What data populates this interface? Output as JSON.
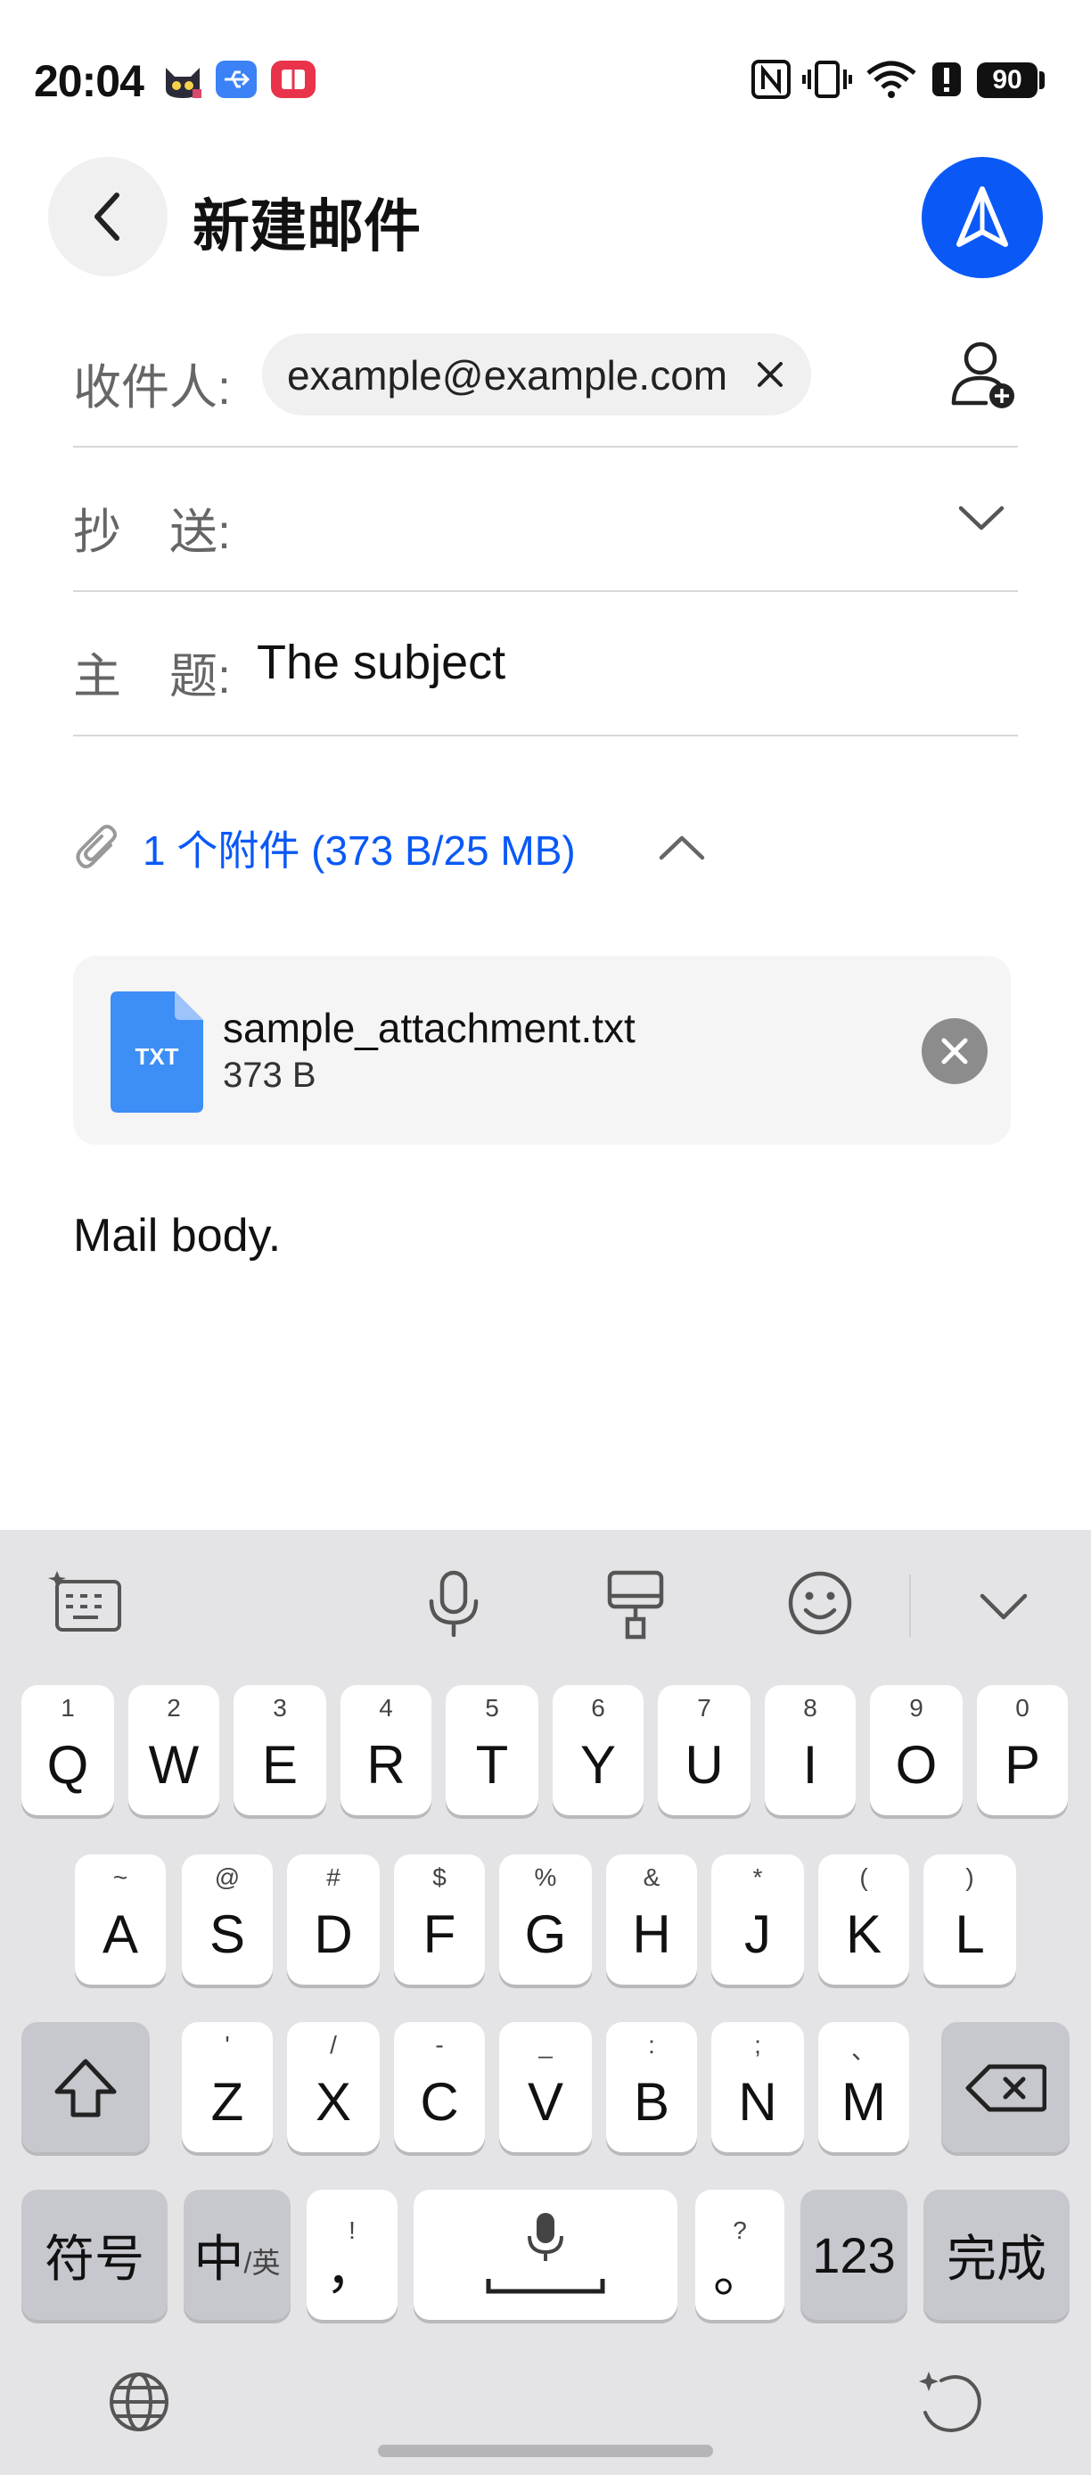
{
  "status_bar": {
    "time": "20:04",
    "battery": "90",
    "icons": [
      "cat-app-icon",
      "usb-icon",
      "app-notification-icon",
      "nfc-icon",
      "vibrate-icon",
      "wifi-icon",
      "alert-icon",
      "battery-icon"
    ]
  },
  "header": {
    "title": "新建邮件",
    "back_icon": "back-arrow-icon",
    "send_icon": "send-icon"
  },
  "compose": {
    "to_label": "收件人:",
    "to_chip": "example@example.com",
    "cc_label": "抄　送:",
    "subject_label": "主　题:",
    "subject_value": "The subject",
    "attachment_summary": "1 个附件 (373 B/25 MB)",
    "attachment": {
      "name": "sample_attachment.txt",
      "size": "373 B",
      "type_badge": "TXT"
    },
    "body": "Mail body."
  },
  "keyboard": {
    "row1": [
      {
        "main": "Q",
        "sub": "1"
      },
      {
        "main": "W",
        "sub": "2"
      },
      {
        "main": "E",
        "sub": "3"
      },
      {
        "main": "R",
        "sub": "4"
      },
      {
        "main": "T",
        "sub": "5"
      },
      {
        "main": "Y",
        "sub": "6"
      },
      {
        "main": "U",
        "sub": "7"
      },
      {
        "main": "I",
        "sub": "8"
      },
      {
        "main": "O",
        "sub": "9"
      },
      {
        "main": "P",
        "sub": "0"
      }
    ],
    "row2": [
      {
        "main": "A",
        "sub": "~"
      },
      {
        "main": "S",
        "sub": "@"
      },
      {
        "main": "D",
        "sub": "#"
      },
      {
        "main": "F",
        "sub": "$"
      },
      {
        "main": "G",
        "sub": "%"
      },
      {
        "main": "H",
        "sub": "&"
      },
      {
        "main": "J",
        "sub": "*"
      },
      {
        "main": "K",
        "sub": "("
      },
      {
        "main": "L",
        "sub": ")"
      }
    ],
    "row3": [
      {
        "main": "Z",
        "sub": "'"
      },
      {
        "main": "X",
        "sub": "/"
      },
      {
        "main": "C",
        "sub": "-"
      },
      {
        "main": "V",
        "sub": "_"
      },
      {
        "main": "B",
        "sub": ":"
      },
      {
        "main": "N",
        "sub": ";"
      },
      {
        "main": "M",
        "sub": "、"
      }
    ],
    "symbols_key": "符号",
    "lang_key_main": "中",
    "lang_key_sub": "/英",
    "comma_key_main": "，",
    "comma_key_sub": "!",
    "period_key_main": "。",
    "period_key_sub": "?",
    "numbers_key": "123",
    "done_key": "完成"
  },
  "colors": {
    "accent": "#0a59f7",
    "keyboard_bg": "#e4e4e6",
    "key_dark": "#c6c8cd"
  }
}
